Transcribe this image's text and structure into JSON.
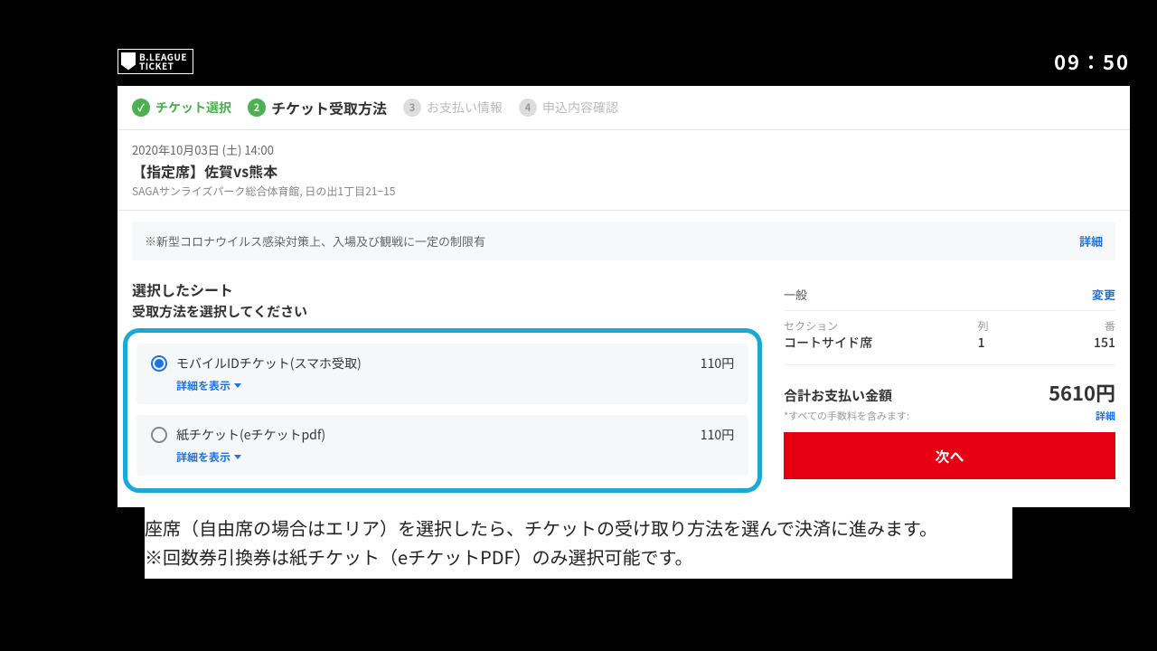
{
  "header": {
    "logo_line1": "B.LEAGUE",
    "logo_line2": "TICKET",
    "clock": "09：50"
  },
  "steps": {
    "s1": {
      "num": "",
      "label": "チケット選択"
    },
    "s2": {
      "num": "2",
      "label": "チケット受取方法"
    },
    "s3": {
      "num": "3",
      "label": "お支払い情報"
    },
    "s4": {
      "num": "4",
      "label": "申込内容確認"
    }
  },
  "event": {
    "datetime": "2020年10月03日 (土) 14:00",
    "title": "【指定席】佐賀vs熊本",
    "venue": "SAGAサンライズパーク総合体育館, 日の出1丁目21−15"
  },
  "notice": {
    "text": "※新型コロナウイルス感染対策上、入場及び観戦に一定の制限有",
    "link": "詳細"
  },
  "left": {
    "heading": "選択したシート",
    "subheading": "受取方法を選択してください",
    "options": [
      {
        "name": "モバイルIDチケット(スマホ受取)",
        "price": "110円",
        "detail": "詳細を表示",
        "checked": true
      },
      {
        "name": "紙チケット(eチケットpdf)",
        "price": "110円",
        "detail": "詳細を表示",
        "checked": false
      }
    ]
  },
  "summary": {
    "category": "一般",
    "change": "変更",
    "section_label": "セクション",
    "section_value": "コートサイド席",
    "row_label": "列",
    "row_value": "1",
    "seat_label": "番",
    "seat_value": "151",
    "total_label": "合計お支払い金額",
    "total_value": "5610円",
    "fee_note": "*すべての手数料を含みます:",
    "fee_link": "詳細",
    "next": "次へ"
  },
  "caption": {
    "line1": "座席（自由席の場合はエリア）を選択したら、チケットの受け取り方法を選んで決済に進みます。",
    "line2": "※回数券引換券は紙チケット（eチケットPDF）のみ選択可能です。"
  }
}
